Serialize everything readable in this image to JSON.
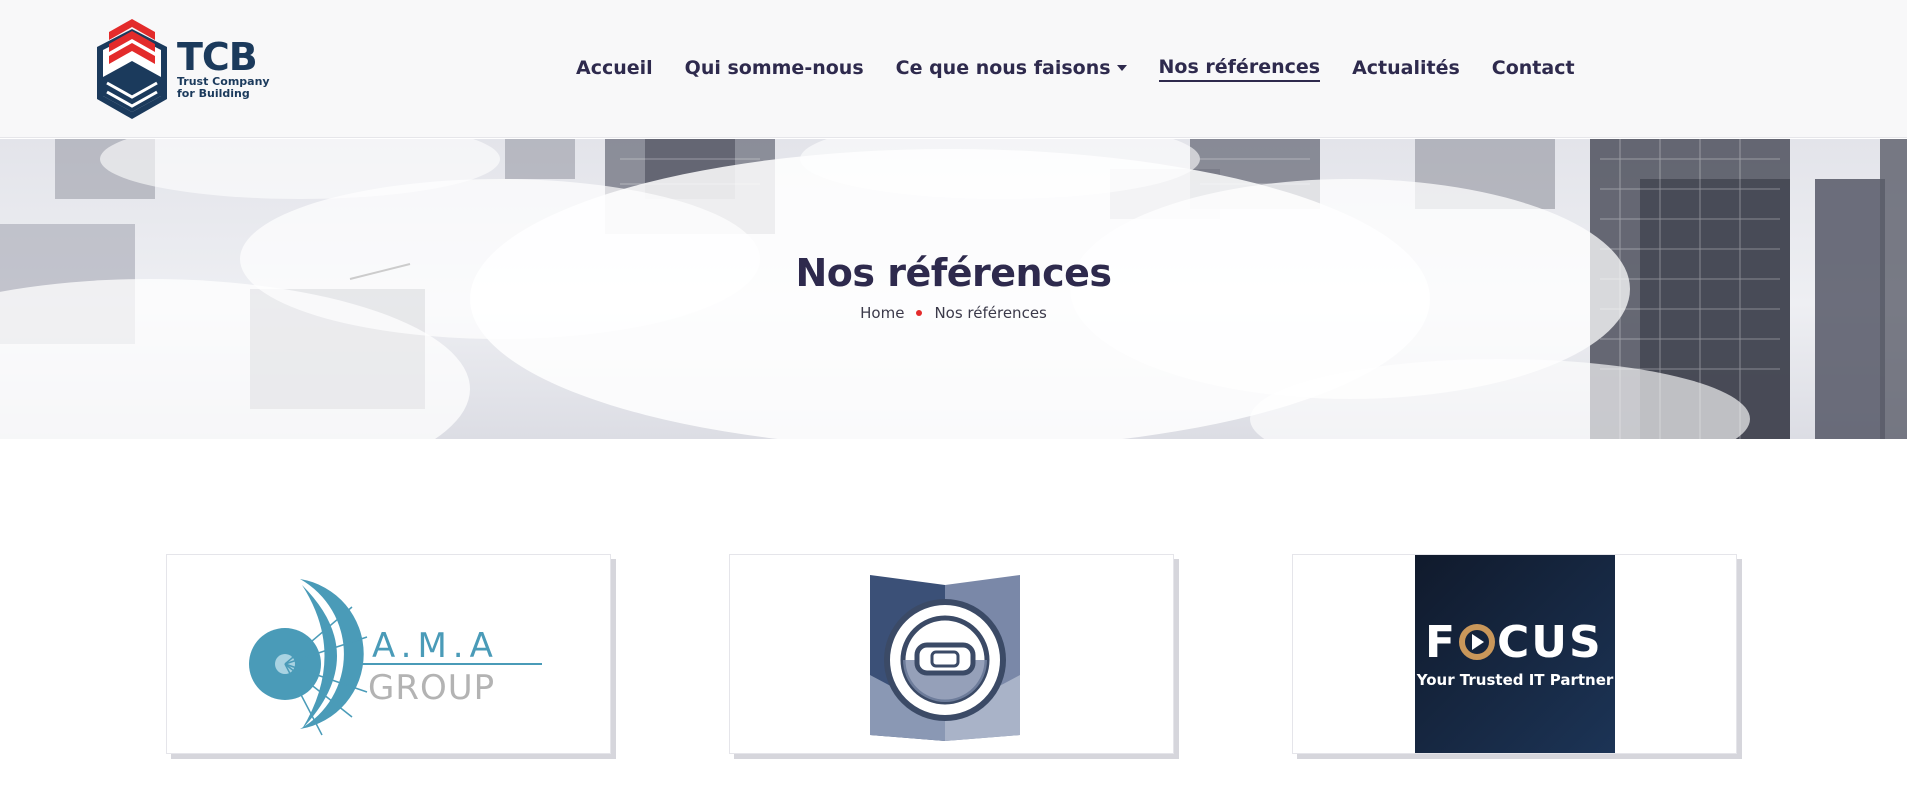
{
  "header": {
    "logo": {
      "name": "TCB",
      "subtitle_line1": "Trust Company",
      "subtitle_line2": "for Building"
    },
    "nav": {
      "items": [
        {
          "label": "Accueil"
        },
        {
          "label": "Qui somme-nous"
        },
        {
          "label": "Ce que nous faisons"
        },
        {
          "label": "Nos références"
        },
        {
          "label": "Actualités"
        },
        {
          "label": "Contact"
        }
      ],
      "active": "Nos références"
    }
  },
  "hero": {
    "title": "Nos références",
    "breadcrumb": {
      "home": "Home",
      "current": "Nos références"
    }
  },
  "references": [
    {
      "name": "A.M.A GROUP",
      "line1": "A.M.A",
      "line2": "GROUP"
    },
    {
      "name": "steering-wheel-logo"
    },
    {
      "name": "FOCUS",
      "line1": "FOCUS",
      "line2": "Your Trusted IT Partner"
    }
  ],
  "colors": {
    "navy": "#2e2a4d",
    "logo_blue": "#1b3a5c",
    "logo_red": "#e32b2b",
    "ama_blue": "#4a9bb8",
    "ama_gray": "#b3b3b3",
    "focus_bg": "#13203a",
    "focus_gold": "#c9975a"
  }
}
